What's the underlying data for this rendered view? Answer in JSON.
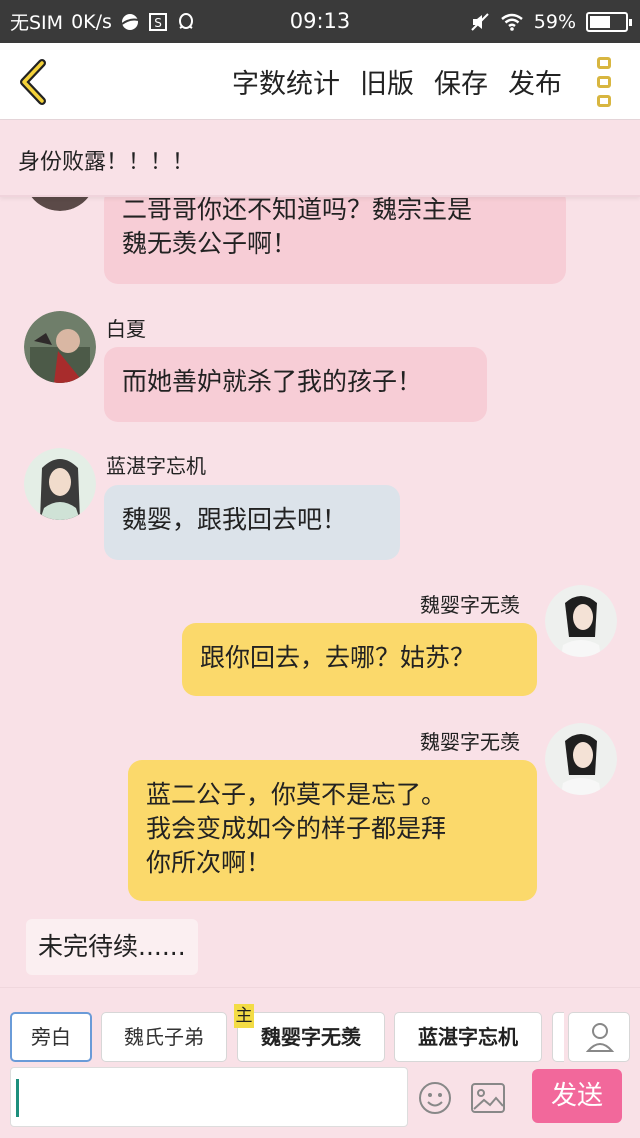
{
  "status_bar": {
    "carrier": "无SIM",
    "speed": "0K/s",
    "time": "09:13",
    "battery": "59%",
    "battery_level": 0.59
  },
  "header": {
    "actions": [
      "字数统计",
      "旧版",
      "保存",
      "发布"
    ]
  },
  "title": "身份败露！！！！",
  "messages": [
    {
      "side": "left",
      "name": "",
      "text": "二哥哥你还不知道吗？魏宗主是\n魏无羡公子啊！",
      "color": "pink"
    },
    {
      "side": "left",
      "name": "白夏",
      "text": "而她善妒就杀了我的孩子！",
      "color": "pink"
    },
    {
      "side": "left",
      "name": "蓝湛字忘机",
      "text": "魏婴，跟我回去吧！",
      "color": "blue"
    },
    {
      "side": "right",
      "name": "魏婴字无羡",
      "text": "跟你回去，去哪？姑苏？",
      "color": "yellow"
    },
    {
      "side": "right",
      "name": "魏婴字无羡",
      "text": "蓝二公子，你莫不是忘了。\n我会变成如今的样子都是拜\n你所次啊！",
      "color": "yellow"
    }
  ],
  "narration": "未完待续......",
  "roles": [
    "旁白",
    "魏氏子弟",
    "魏婴字无羡",
    "蓝湛字忘机"
  ],
  "role_tag": "主",
  "input": {
    "value": "",
    "placeholder": ""
  },
  "send_label": "发送",
  "colors": {
    "accent": "#f2689b",
    "yellow": "#fbd96b",
    "pink": "#f7cdd6",
    "blue": "#dce3ea",
    "background": "#f9e1e7"
  }
}
